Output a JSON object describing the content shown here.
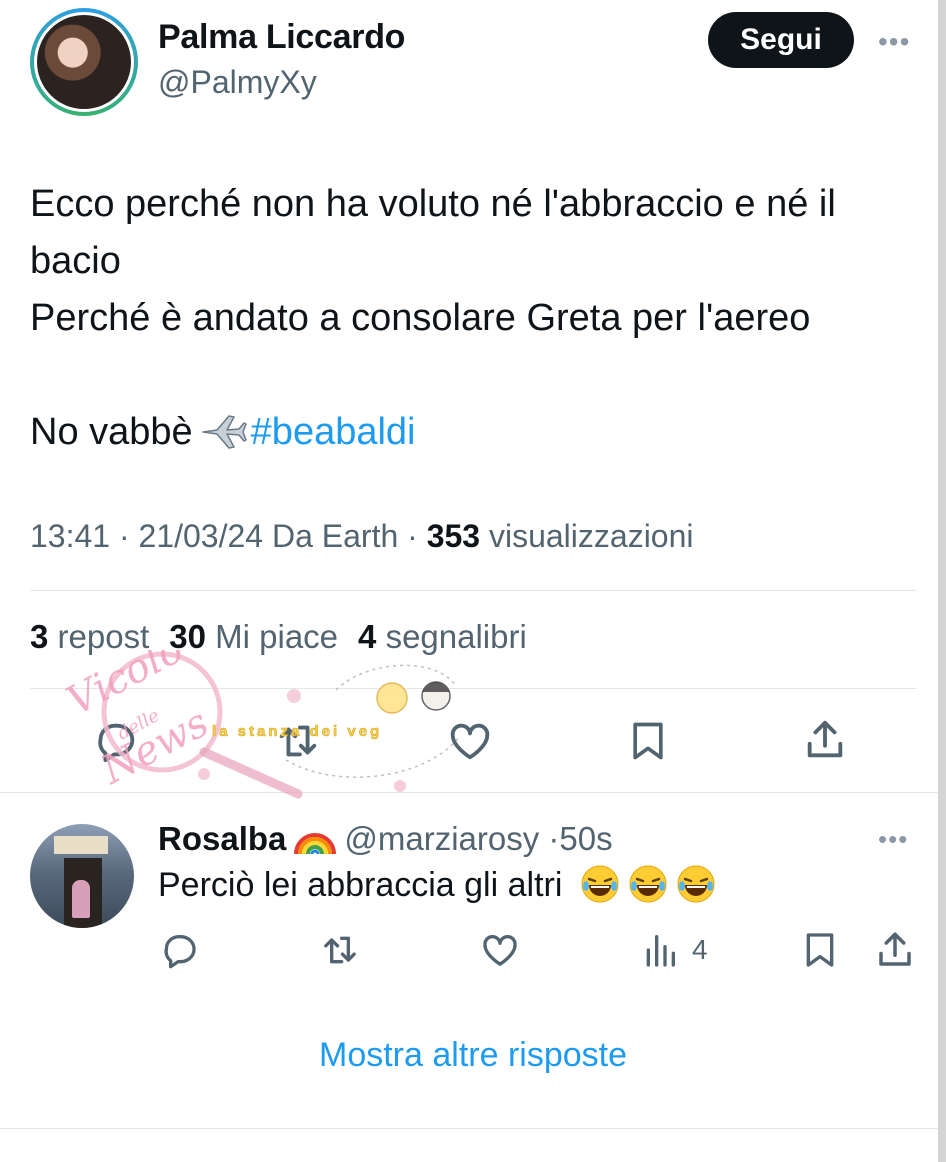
{
  "tweet": {
    "author_name": "Palma Liccardo",
    "author_handle": "@PalmyXy",
    "follow_label": "Segui",
    "more_label": "•••",
    "text_line1": "Ecco perché non ha voluto né l'abbraccio e né il",
    "text_line2": "bacio",
    "text_line3": "Perché è andato a consolare Greta per l'aereo",
    "text_line5": "No vabbè",
    "hashtag": "#beabaldi",
    "time": "13:41",
    "date": "21/03/24",
    "source": "Da Earth",
    "separator": "·",
    "views_count": "353",
    "views_label": "visualizzazioni",
    "reposts_count": "3",
    "reposts_label": "repost",
    "likes_count": "30",
    "likes_label": "Mi piace",
    "bookmarks_count": "4",
    "bookmarks_label": "segnalibri",
    "icons": [
      "reply-icon",
      "repost-icon",
      "like-icon",
      "bookmark-icon",
      "share-icon"
    ]
  },
  "reply": {
    "author_name": "Rosalba",
    "author_handle": "@marziarosy",
    "time": "·50s",
    "text": "Perciò lei abbraccia gli altri",
    "views_count": "4",
    "more_label": "•••",
    "icons": [
      "reply-icon",
      "repost-icon",
      "like-icon",
      "views-icon",
      "bookmark-icon",
      "share-icon"
    ]
  },
  "show_more_label": "Mostra altre risposte",
  "watermark": {
    "text1": "Vicolo",
    "text2": "delle",
    "text3": "News",
    "text4": "la stanza dei veg"
  },
  "colors": {
    "text": "#0f1419",
    "secondary": "#536471",
    "link": "#1d9bf0",
    "divider": "#e3e6e8",
    "follow_bg": "#0f1419"
  }
}
